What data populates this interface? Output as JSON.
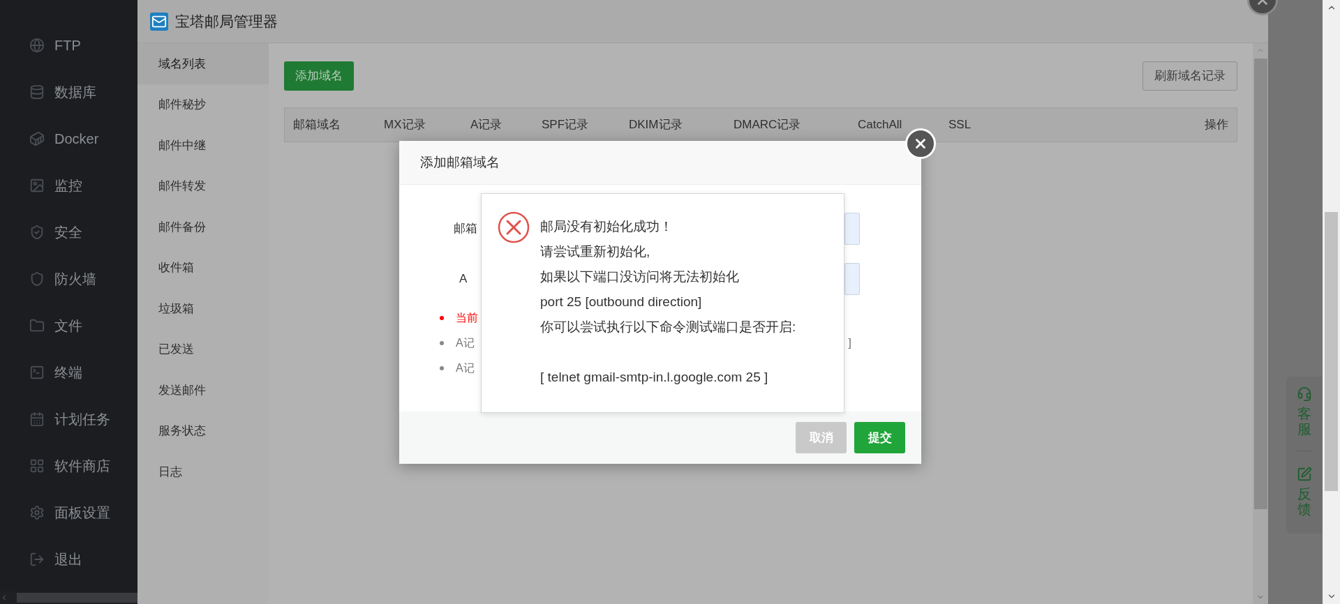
{
  "sidebar": {
    "items": [
      {
        "label": "FTP"
      },
      {
        "label": "数据库"
      },
      {
        "label": "Docker"
      },
      {
        "label": "监控"
      },
      {
        "label": "安全"
      },
      {
        "label": "防火墙"
      },
      {
        "label": "文件"
      },
      {
        "label": "终端"
      },
      {
        "label": "计划任务"
      },
      {
        "label": "软件商店"
      },
      {
        "label": "面板设置"
      },
      {
        "label": "退出"
      }
    ]
  },
  "plugin_window": {
    "title": "宝塔邮局管理器",
    "nav": [
      {
        "label": "域名列表",
        "selected": true
      },
      {
        "label": "邮件秘抄",
        "selected": false
      },
      {
        "label": "邮件中继",
        "selected": false
      },
      {
        "label": "邮件转发",
        "selected": false
      },
      {
        "label": "邮件备份",
        "selected": false
      },
      {
        "label": "收件箱",
        "selected": false
      },
      {
        "label": "垃圾箱",
        "selected": false
      },
      {
        "label": "已发送",
        "selected": false
      },
      {
        "label": "发送邮件",
        "selected": false
      },
      {
        "label": "服务状态",
        "selected": false
      },
      {
        "label": "日志",
        "selected": false
      }
    ],
    "add_button": "添加域名",
    "refresh_button": "刷新域名记录",
    "table": {
      "columns": [
        "邮箱域名",
        "MX记录",
        "A记录",
        "SPF记录",
        "DKIM记录",
        "DMARC记录",
        "CatchAll",
        "SSL",
        "操作"
      ]
    }
  },
  "dialog": {
    "title": "添加邮箱域名",
    "fields": [
      {
        "label": "邮箱"
      },
      {
        "label": "A"
      }
    ],
    "notes": [
      {
        "text": "当前",
        "kind": "warning"
      },
      {
        "text": "A记",
        "kind": "info",
        "tail": "]"
      },
      {
        "text": "A记",
        "kind": "info"
      }
    ],
    "buttons": [
      {
        "label": "取消",
        "kind": "cancel"
      },
      {
        "label": "提交",
        "kind": "primary"
      }
    ]
  },
  "alert": {
    "lines": [
      "邮局没有初始化成功！",
      "请尝试重新初始化,",
      "如果以下端口没访问将无法初始化",
      "port 25 [outbound direction]",
      "你可以尝试执行以下命令测试端口是否开启:"
    ],
    "command": "[ telnet gmail-smtp-in.l.google.com 25 ]"
  },
  "support_widget": {
    "items": [
      {
        "label": "客服"
      },
      {
        "label": "反馈"
      }
    ]
  }
}
